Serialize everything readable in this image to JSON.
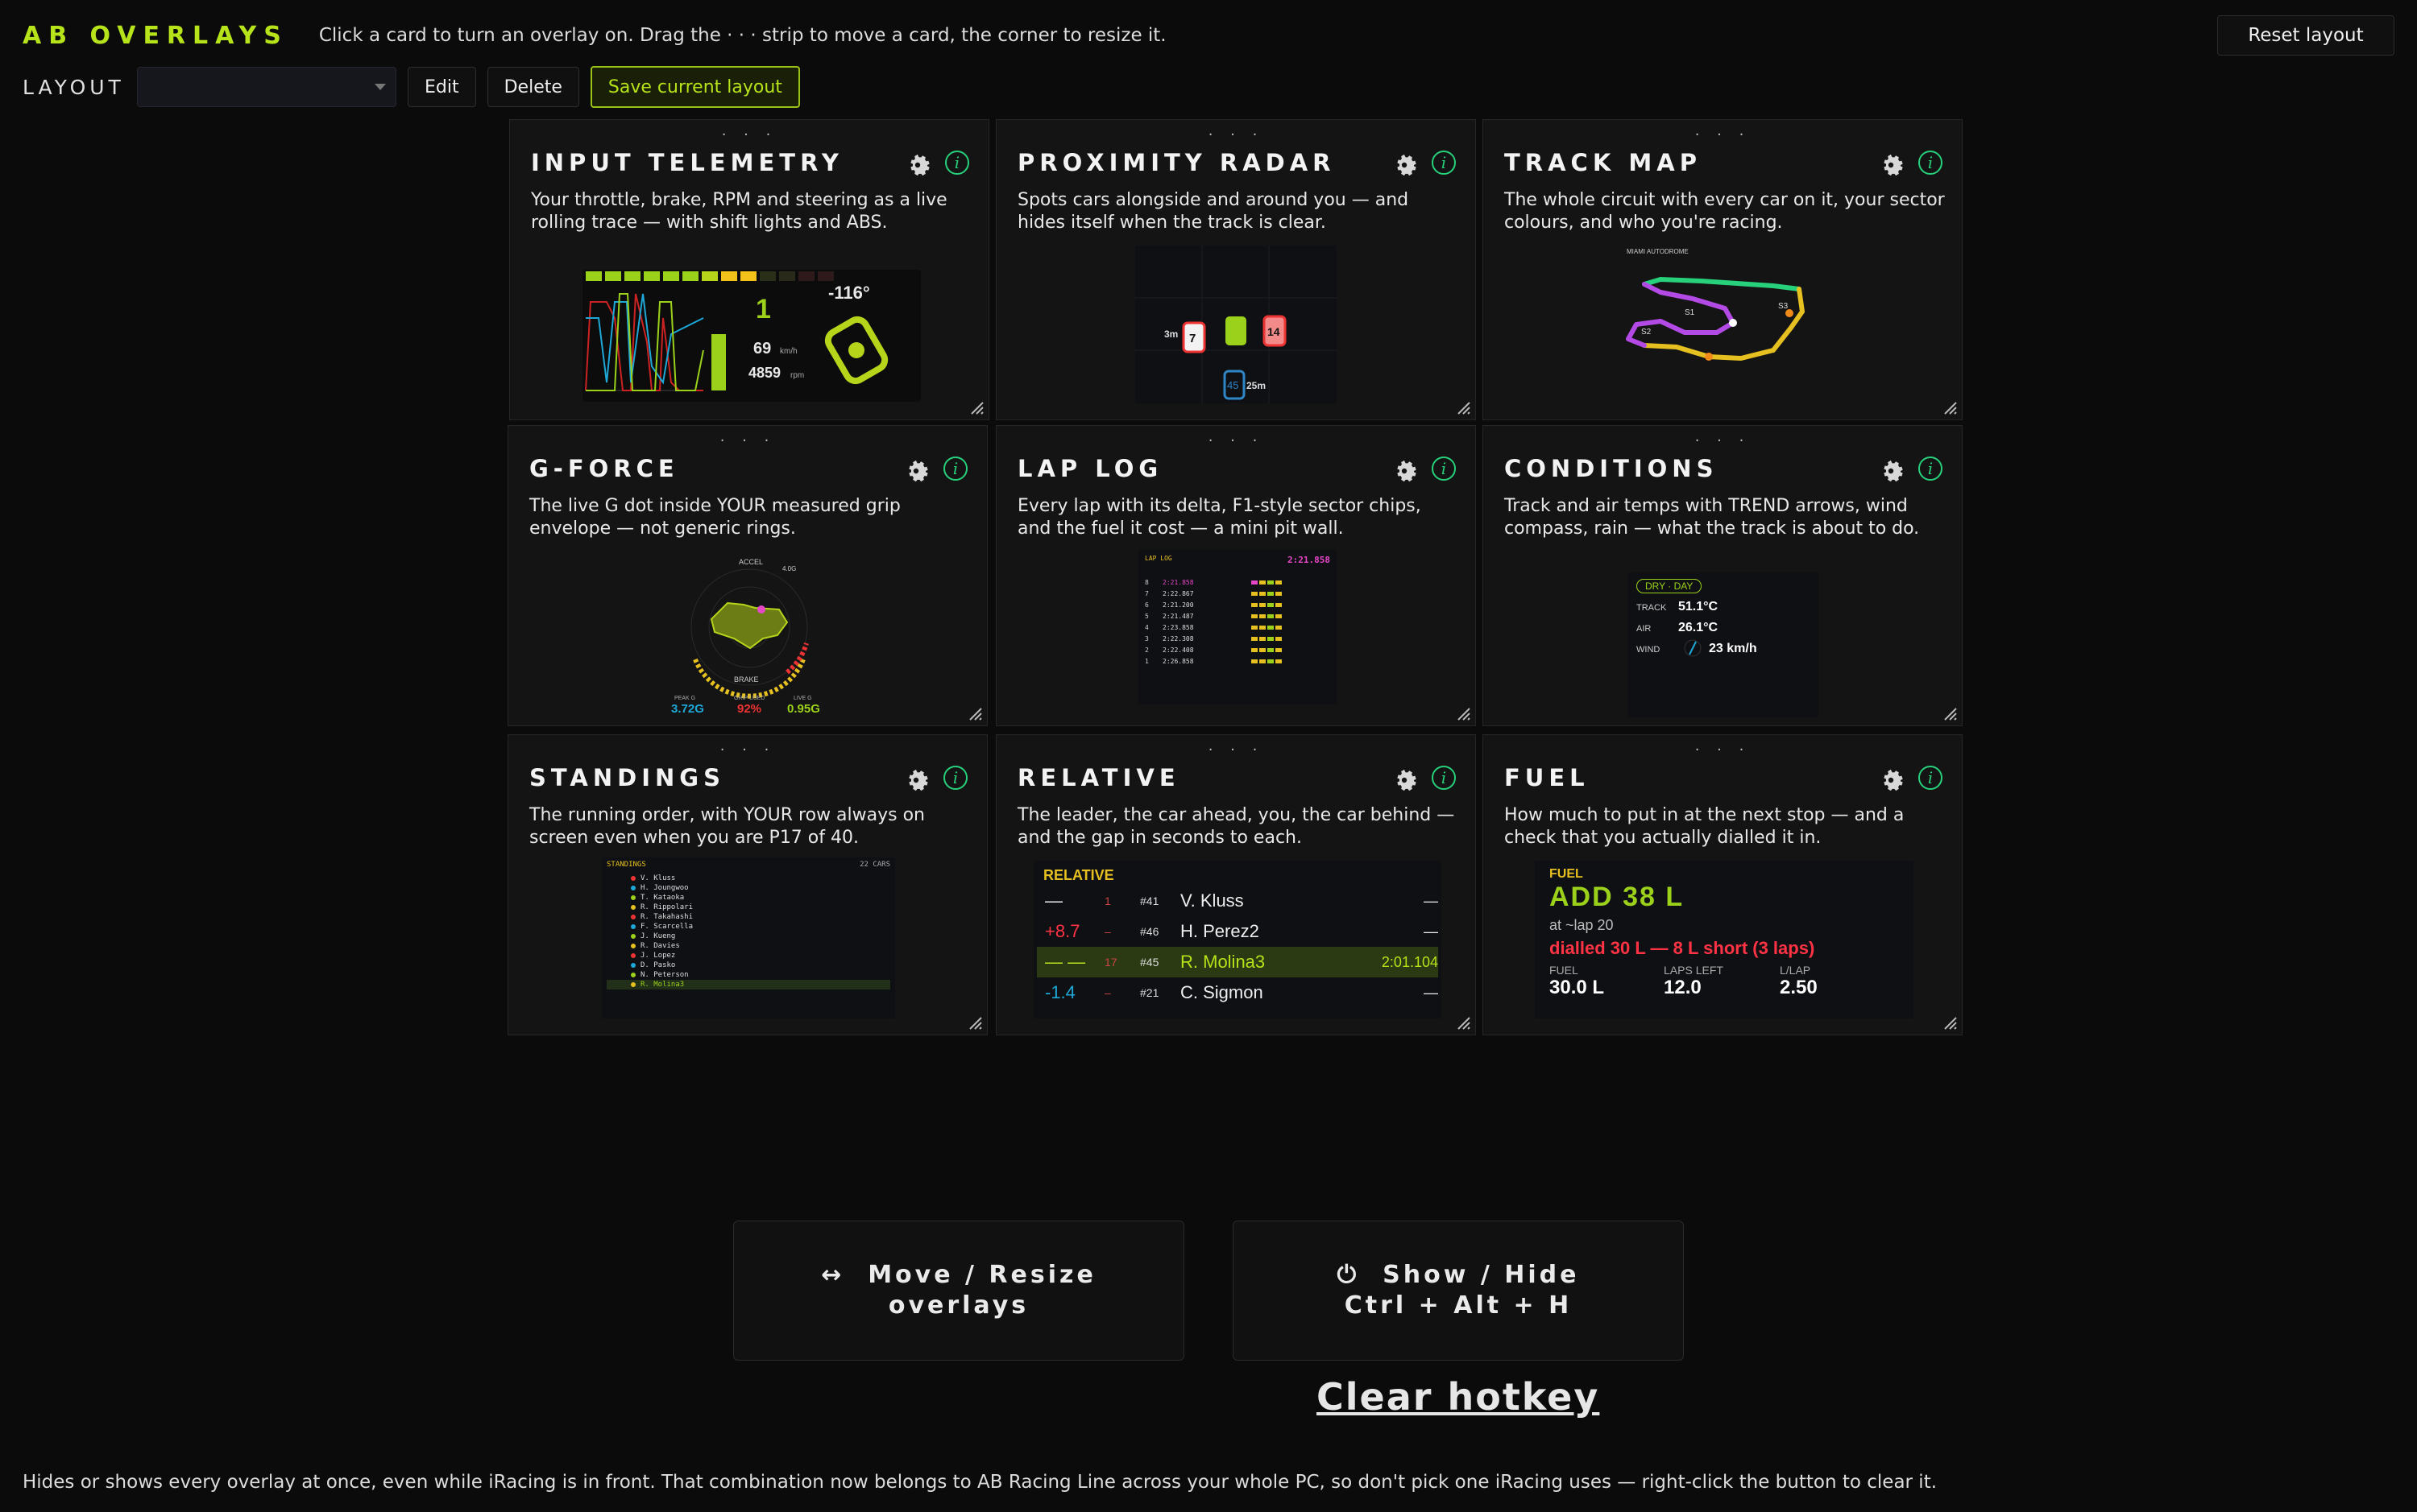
{
  "app": {
    "brand": "AB OVERLAYS",
    "hint": "Click a card to turn an overlay on. Drag the · · · strip to move a card, the corner to resize it.",
    "reset_label": "Reset layout"
  },
  "layout_bar": {
    "label": "LAYOUT",
    "select_value": "",
    "edit_label": "Edit",
    "delete_label": "Delete",
    "save_label": "Save current layout"
  },
  "cards": [
    {
      "title": "INPUT TELEMETRY",
      "desc": "Your throttle, brake, RPM and steering as a live rolling trace — with shift lights and ABS."
    },
    {
      "title": "PROXIMITY RADAR",
      "desc": "Spots cars alongside and around you — and hides itself when the track is clear."
    },
    {
      "title": "TRACK MAP",
      "desc": "The whole circuit with every car on it, your sector colours, and who you're racing."
    },
    {
      "title": "G-FORCE",
      "desc": "The live G dot inside YOUR measured grip envelope — not generic rings."
    },
    {
      "title": "LAP LOG",
      "desc": "Every lap with its delta, F1-style sector chips, and the fuel it cost — a mini pit wall."
    },
    {
      "title": "CONDITIONS",
      "desc": "Track and air temps with TREND arrows, wind compass, rain — what the track is about to do."
    },
    {
      "title": "STANDINGS",
      "desc": "The running order, with YOUR row always on screen even when you are P17 of 40."
    },
    {
      "title": "RELATIVE",
      "desc": "The leader, the car ahead, you, the car behind — and the gap in seconds to each."
    },
    {
      "title": "FUEL",
      "desc": "How much to put in at the next stop — and a check that you actually dialled it in."
    }
  ],
  "telemetry": {
    "gear": "1",
    "steer": "-116°",
    "speed": "69",
    "speed_unit": "km/h",
    "rpm": "4859",
    "rpm_unit": "rpm"
  },
  "radar": {
    "left_gap": "3m",
    "left_car": "7",
    "right_car": "14",
    "behind_car": "45",
    "behind_gap": "25m"
  },
  "trackmap": {
    "header": "MIAMI AUTODROME",
    "s1": "S1",
    "s2": "S2",
    "s3": "S3"
  },
  "gforce": {
    "top_label": "ACCEL",
    "top_value": "4.0G",
    "bottom_label": "BRAKE",
    "peak_label": "PEAK G",
    "peak_value": "3.72G",
    "used_label": "GRIP USED",
    "used_value": "92%",
    "live_label": "LIVE G",
    "live_value": "0.95G"
  },
  "laplog": {
    "title": "LAP LOG",
    "best_time": "2:21.858",
    "rows": [
      {
        "lap": "8",
        "time": "2:21.858"
      },
      {
        "lap": "7",
        "time": "2:22.867"
      },
      {
        "lap": "6",
        "time": "2:21.200"
      },
      {
        "lap": "5",
        "time": "2:21.487"
      },
      {
        "lap": "4",
        "time": "2:23.858"
      },
      {
        "lap": "3",
        "time": "2:22.308"
      },
      {
        "lap": "2",
        "time": "2:22.408"
      },
      {
        "lap": "1",
        "time": "2:26.858"
      }
    ]
  },
  "conditions": {
    "badge": "DRY · DAY",
    "track_label": "TRACK",
    "track_value": "51.1°C",
    "air_label": "AIR",
    "air_value": "26.1°C",
    "wind_label": "WIND",
    "wind_value": "23 km/h"
  },
  "standings": {
    "title": "STANDINGS",
    "cars": "22 CARS",
    "rows": [
      "V. Kluss",
      "H. Joungwoo",
      "T. Kataoka",
      "R. Rippolari",
      "R. Takahashi",
      "F. Scarcella",
      "J. Kueng",
      "R. Davies",
      "J. Lopez",
      "D. Pasko",
      "N. Peterson",
      "R. Molina3"
    ]
  },
  "relative": {
    "title": "RELATIVE",
    "rows": [
      {
        "gap": "—",
        "pos": "1",
        "num": "#41",
        "name": "V. Kluss",
        "time": "—"
      },
      {
        "gap": "+8.7",
        "pos": "–",
        "num": "#46",
        "name": "H. Perez2",
        "time": "—"
      },
      {
        "gap": "— —",
        "pos": "17",
        "num": "#45",
        "name": "R. Molina3",
        "time": "2:01.104"
      },
      {
        "gap": "-1.4",
        "pos": "–",
        "num": "#21",
        "name": "C. Sigmon",
        "time": "—"
      }
    ]
  },
  "fuel": {
    "label": "FUEL",
    "add": "ADD 38 L",
    "at_lap": "at ~lap 20",
    "warning": "dialled 30 L — 8 L short (3 laps)",
    "fuel_label": "FUEL",
    "fuel_value": "30.0 L",
    "laps_label": "LAPS LEFT",
    "laps_value": "12.0",
    "perlap_label": "L/LAP",
    "perlap_value": "2.50"
  },
  "bottom": {
    "move_icon": "↔",
    "move_line1": "Move / Resize",
    "move_line2": "overlays",
    "show_icon": "⏻",
    "show_line1": "Show / Hide",
    "show_line2": "Ctrl + Alt + H",
    "clear_label": "Clear hotkey",
    "footer": "Hides or shows every overlay at once, even while iRacing is in front. That combination now belongs to AB Racing Line across your whole PC, so don't pick one iRacing uses — right-click the button to clear it."
  },
  "colors": {
    "accent": "#b6e31a",
    "info": "#27d07a",
    "bg": "#0b0b0c",
    "card": "#141414"
  }
}
